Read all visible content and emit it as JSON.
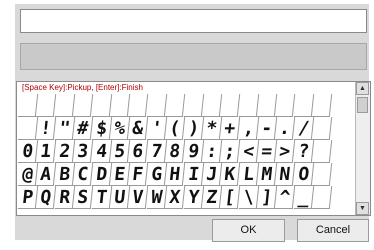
{
  "dialog": {
    "hint": "[Space Key]:Pickup, [Enter]:Finish",
    "ok_label": "OK",
    "cancel_label": "Cancel"
  },
  "glyph_rows": [
    [
      "",
      "",
      "",
      "",
      "",
      "",
      "",
      "",
      "",
      "",
      "",
      "",
      "",
      "",
      "",
      "",
      ""
    ],
    [
      "",
      "!",
      "\"",
      "#",
      "$",
      "%",
      "&",
      "'",
      "(",
      ")",
      "*",
      "+",
      ",",
      "-",
      ".",
      "/",
      ""
    ],
    [
      "0",
      "1",
      "2",
      "3",
      "4",
      "5",
      "6",
      "7",
      "8",
      "9",
      ":",
      ";",
      "<",
      "=",
      ">",
      "?",
      ""
    ],
    [
      "@",
      "A",
      "B",
      "C",
      "D",
      "E",
      "F",
      "G",
      "H",
      "I",
      "J",
      "K",
      "L",
      "M",
      "N",
      "O",
      ""
    ],
    [
      "P",
      "Q",
      "R",
      "S",
      "T",
      "U",
      "V",
      "W",
      "X",
      "Y",
      "Z",
      "[",
      "\\",
      "]",
      "^",
      "_",
      ""
    ]
  ],
  "scrollbar": {
    "up_icon": "arrow-up-icon",
    "down_icon": "arrow-down-icon"
  }
}
